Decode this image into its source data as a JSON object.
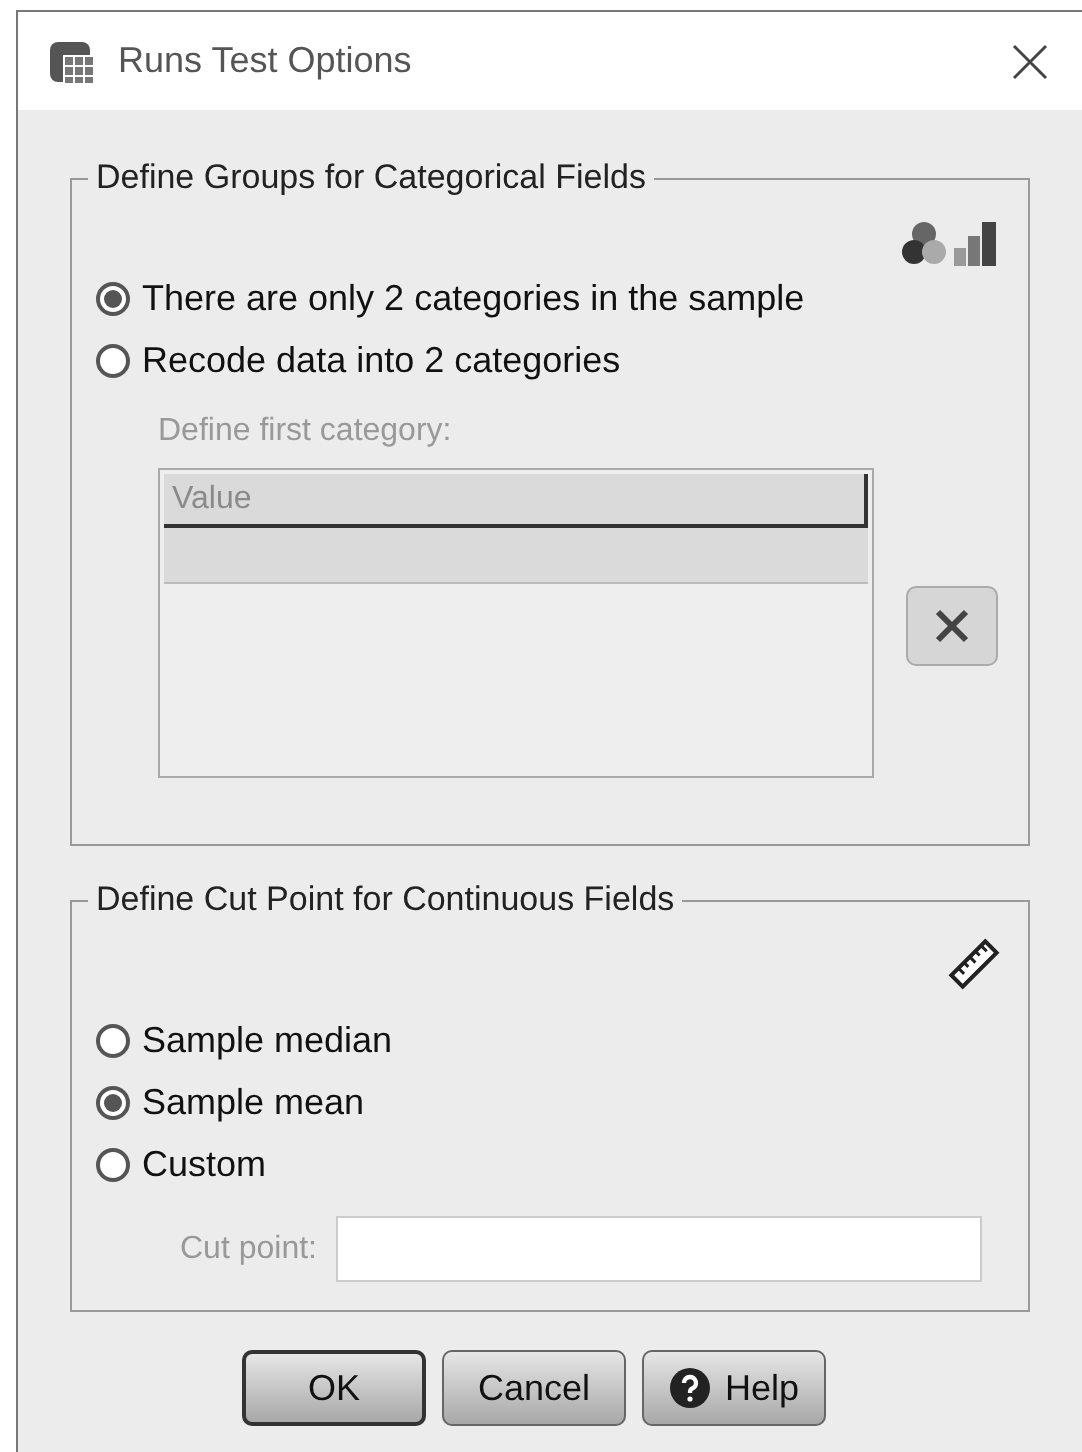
{
  "window": {
    "title": "Runs Test Options"
  },
  "categorical": {
    "title": "Define Groups for Categorical Fields",
    "options": [
      {
        "label": "There are only 2 categories in the sample",
        "selected": true
      },
      {
        "label": "Recode data into 2 categories",
        "selected": false
      }
    ],
    "first_category": {
      "label": "Define first category:",
      "disabled": true,
      "placeholder": "Value"
    }
  },
  "continuous": {
    "title": "Define Cut Point for Continuous Fields",
    "options": [
      {
        "label": "Sample median",
        "selected": false
      },
      {
        "label": "Sample mean",
        "selected": true
      },
      {
        "label": "Custom",
        "selected": false
      }
    ],
    "cut_point": {
      "label": "Cut point:",
      "disabled": true
    }
  },
  "buttons": [
    {
      "label": "OK",
      "kind": "default"
    },
    {
      "label": "Cancel",
      "kind": "plain"
    },
    {
      "label": "Help",
      "kind": "help"
    }
  ]
}
